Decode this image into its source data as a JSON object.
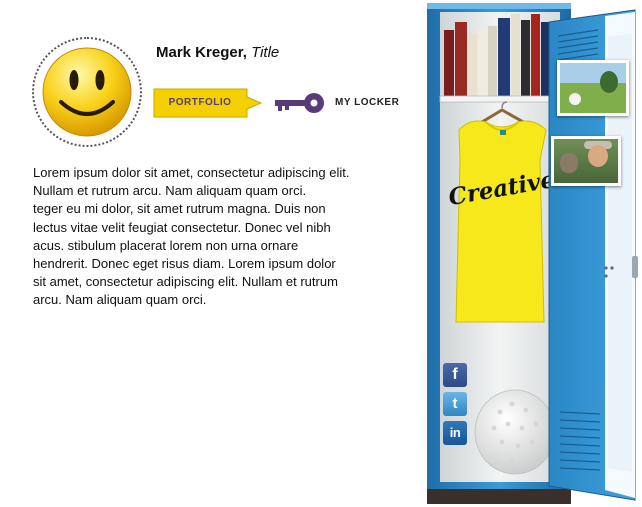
{
  "profile": {
    "name": "Mark Kreger,",
    "title": "Title",
    "avatar_icon": "smiley-face-icon"
  },
  "nav": {
    "portfolio_label": "PORTFOLIO",
    "locker_label": "MY LOCKER",
    "locker_icon": "key-icon"
  },
  "bio": {
    "text": "Lorem ipsum dolor sit amet, consectetur adipiscing elit.\nNullam et rutrum arcu. Nam aliquam quam orci.\nteger eu mi dolor, sit amet rutrum magna. Duis non\nlectus vitae velit feugiat consectetur. Donec vel nibh\nacus. stibulum placerat lorem non urna ornare\n hendrerit. Donec eget risus diam. Lorem ipsum dolor\nsit amet, consectetur adipiscing elit. Nullam et rutrum\narcu. Nam aliquam quam orci."
  },
  "locker": {
    "shirt_text": "Creative",
    "social": {
      "facebook": "f",
      "twitter": "t",
      "linkedin": "in"
    },
    "colors": {
      "locker_blue": "#2f8fcf",
      "shirt_yellow": "#f7e81c",
      "button_yellow": "#f5d000",
      "key_purple": "#5a3b7a"
    }
  }
}
